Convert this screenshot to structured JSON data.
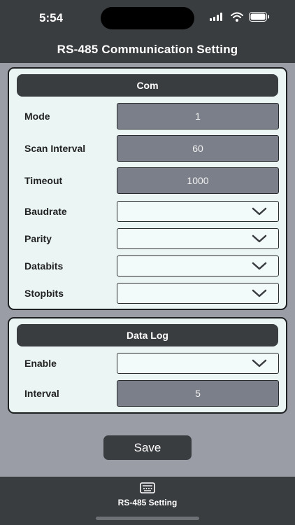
{
  "status_bar": {
    "time": "5:54"
  },
  "nav": {
    "title": "RS-485 Communication Setting"
  },
  "com": {
    "header": "Com",
    "fields": [
      {
        "label": "Mode",
        "value": "1"
      },
      {
        "label": "Scan Interval",
        "value": "60"
      },
      {
        "label": "Timeout",
        "value": "1000"
      }
    ],
    "selects": [
      {
        "label": "Baudrate",
        "value": ""
      },
      {
        "label": "Parity",
        "value": ""
      },
      {
        "label": "Databits",
        "value": ""
      },
      {
        "label": "Stopbits",
        "value": ""
      }
    ]
  },
  "data_log": {
    "header": "Data Log",
    "enable": {
      "label": "Enable",
      "value": ""
    },
    "interval": {
      "label": "Interval",
      "value": "5"
    }
  },
  "actions": {
    "save_label": "Save"
  },
  "tab_bar": {
    "items": [
      {
        "label": "RS-485 Setting",
        "icon": "serial-port-icon"
      }
    ]
  },
  "colors": {
    "background": "#9a9da6",
    "bar": "#3a3d40",
    "panel": "#eaf5f4",
    "value_box": "#7b7f89"
  }
}
